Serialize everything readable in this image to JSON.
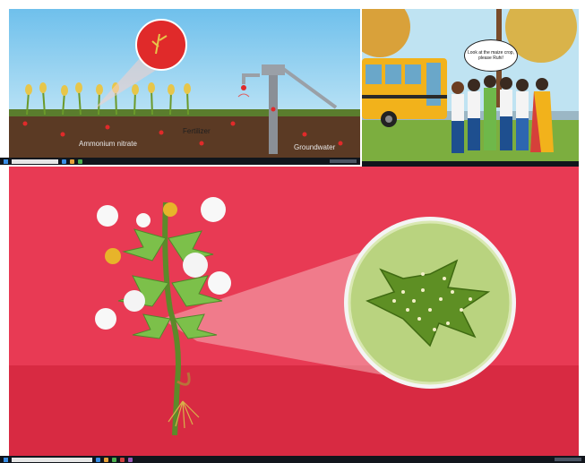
{
  "top_left": {
    "labels": {
      "ammonium_nitrate": "Ammonium nitrate",
      "fertilizer": "Fertilizer",
      "groundwater": "Groundwater"
    }
  },
  "top_right": {
    "speech_bubble": "Look at the maize crop, please Ruhi!"
  },
  "colors": {
    "main_background": "#e8344f",
    "sky_blue": "#8ecdee",
    "soil_brown": "#5b3a24",
    "leaf_green": "#8cc63f",
    "lens_green": "#b9d37f",
    "taskbar": "#11151c"
  }
}
